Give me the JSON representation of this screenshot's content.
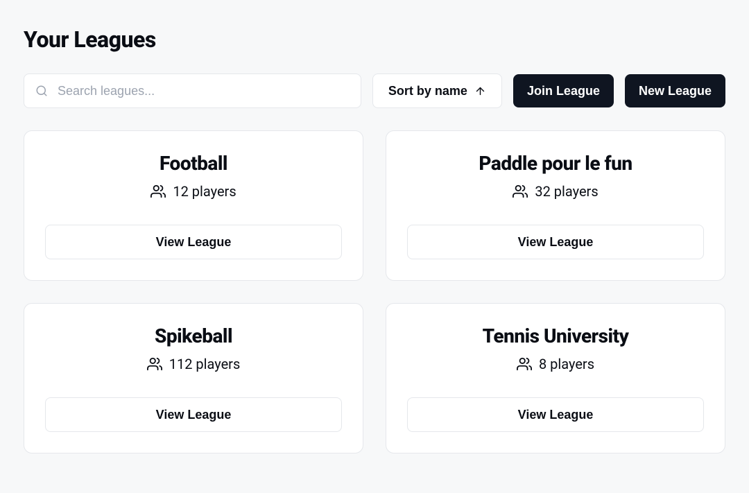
{
  "page": {
    "title": "Your Leagues"
  },
  "search": {
    "placeholder": "Search leagues..."
  },
  "controls": {
    "sort_label": "Sort by name",
    "join_label": "Join League",
    "new_label": "New League"
  },
  "leagues": [
    {
      "name": "Football",
      "players": "12 players",
      "view_label": "View League"
    },
    {
      "name": "Paddle pour le fun",
      "players": "32 players",
      "view_label": "View League"
    },
    {
      "name": "Spikeball",
      "players": "112 players",
      "view_label": "View League"
    },
    {
      "name": "Tennis University",
      "players": "8 players",
      "view_label": "View League"
    }
  ]
}
